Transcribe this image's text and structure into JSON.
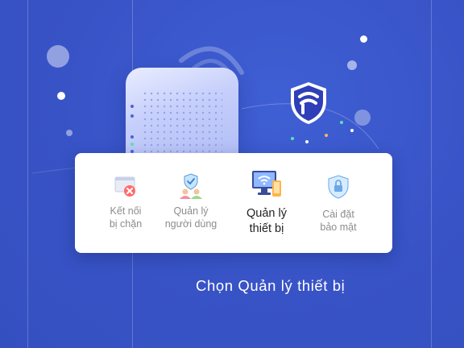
{
  "menu": {
    "items": [
      {
        "label": "Kết nối\nbị chặn",
        "icon": "blocked-connection-icon",
        "active": false
      },
      {
        "label": "Quản lý\nngười dùng",
        "icon": "users-shield-icon",
        "active": false
      },
      {
        "label": "Quản lý\nthiết bị",
        "icon": "devices-icon",
        "active": true
      },
      {
        "label": "Cài đặt\nbảo mật",
        "icon": "security-lock-icon",
        "active": false
      }
    ]
  },
  "caption": "Chọn Quản lý thiết bị",
  "colors": {
    "background": "#3a56c9",
    "card": "#ffffff",
    "accent": "#3350d6",
    "active_text": "#222222",
    "inactive_text": "#8c8c8c"
  }
}
